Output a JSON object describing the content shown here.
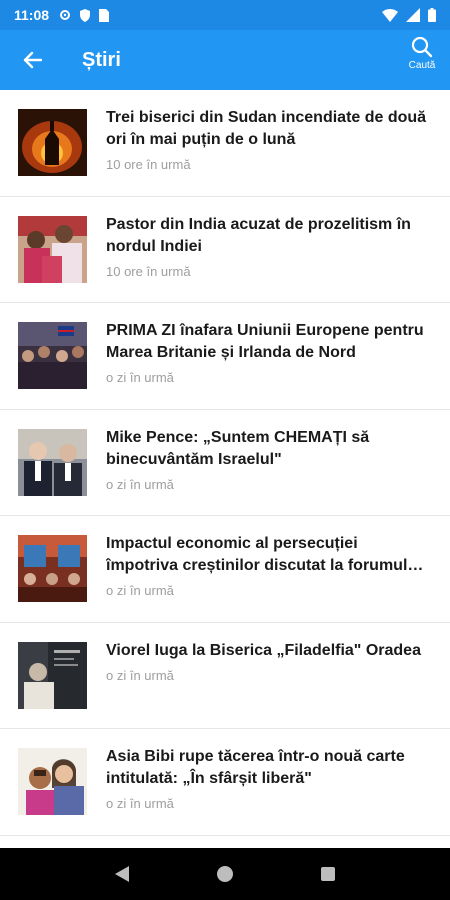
{
  "status_bar": {
    "time": "11:08",
    "icons_left": [
      "settings-icon",
      "shield-icon",
      "sim-icon"
    ],
    "icons_right": [
      "wifi-icon",
      "signal-icon",
      "battery-icon"
    ]
  },
  "app_bar": {
    "title": "Știri",
    "search_label": "Caută",
    "back_icon": "arrow-back-icon",
    "search_icon": "search-icon"
  },
  "articles": [
    {
      "headline": "Trei biserici din Sudan incendiate de două ori în mai puțin de o lună",
      "time": "10 ore în urmă"
    },
    {
      "headline": "Pastor din India acuzat de prozelitism în nordul Indiei",
      "time": "10 ore în urmă"
    },
    {
      "headline": "PRIMA ZI înafara Uniunii Europene pentru Marea Britanie și Irlanda de Nord",
      "time": "o zi în urmă"
    },
    {
      "headline": "Mike Pence: „Suntem CHEMAȚI să binecuvântăm Israelul\"",
      "time": "o zi în urmă"
    },
    {
      "headline": "Impactul economic al persecuției împotriva creștinilor discutat la forumul economic mondial",
      "time": "o zi în urmă"
    },
    {
      "headline": "Viorel Iuga la Biserica „Filadelfia\" Oradea",
      "time": "o zi în urmă"
    },
    {
      "headline": "Asia Bibi rupe tăcerea într-o nouă carte intitulată: „În sfârșit liberă\"",
      "time": "o zi în urmă"
    }
  ],
  "colors": {
    "app_bar": "#2196f3",
    "status_bar": "#1e88e5",
    "headline": "#1a1a1a",
    "time_text": "#9e9e9e"
  },
  "nav_bar": [
    "back-triangle-icon",
    "home-circle-icon",
    "recents-square-icon"
  ]
}
